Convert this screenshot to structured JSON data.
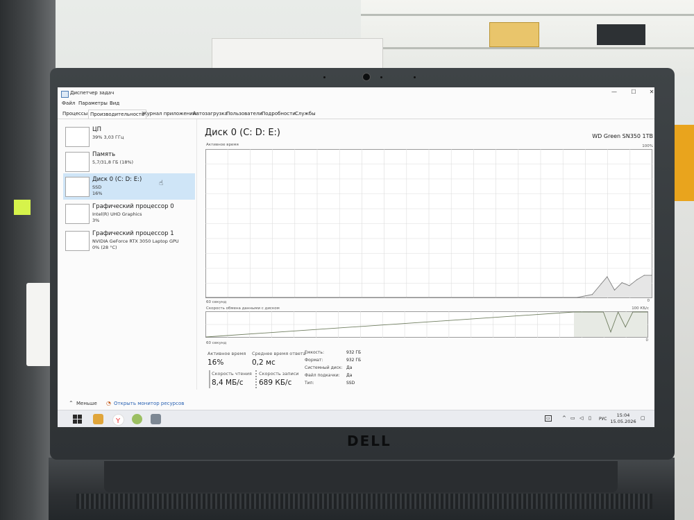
{
  "window": {
    "title": "Диспетчер задач",
    "controls": [
      "—",
      "☐",
      "✕"
    ]
  },
  "menu": [
    "Файл",
    "Параметры",
    "Вид"
  ],
  "tabs": [
    "Процессы",
    "Производительность",
    "Журнал приложений",
    "Автозагрузка",
    "Пользователи",
    "Подробности",
    "Службы"
  ],
  "active_tab_index": 1,
  "sidebar": {
    "items": [
      {
        "name": "ЦП",
        "sub1": "39%  3,03 ГГц",
        "sub2": ""
      },
      {
        "name": "Память",
        "sub1": "5,7/31,8 ГБ (18%)",
        "sub2": ""
      },
      {
        "name": "Диск 0 (C: D: E:)",
        "sub1": "SSD",
        "sub2": "16%"
      },
      {
        "name": "Графический процессор 0",
        "sub1": "Intel(R) UHD Graphics",
        "sub2": "3%"
      },
      {
        "name": "Графический процессор 1",
        "sub1": "NVIDIA GeForce RTX 3050 Laptop GPU",
        "sub2": "0%  (28 °C)"
      }
    ],
    "selected_index": 2
  },
  "main": {
    "title": "Диск 0 (C: D: E:)",
    "model": "WD Green SN350 1TB",
    "chart1": {
      "label": "Активное время",
      "max_label": "100%",
      "time_label": "60 секунд",
      "min_label": "0"
    },
    "chart2": {
      "label": "Скорость обмена данными с диском",
      "max_label": "100 КБ/с",
      "time_label": "60 секунд",
      "min_label": "0"
    }
  },
  "stats": {
    "active_time_label": "Активное время",
    "active_time_value": "16%",
    "avg_response_label": "Среднее время ответа",
    "avg_response_value": "0,2 мс",
    "read_speed_label": "Скорость чтения",
    "read_speed_value": "8,4 МБ/с",
    "write_speed_label": "Скорость записи",
    "write_speed_value": "689 КБ/с",
    "properties": [
      {
        "key": "Емкость:",
        "value": "932 ГБ"
      },
      {
        "key": "Формат:",
        "value": "932 ГБ"
      },
      {
        "key": "Системный диск:",
        "value": "Да"
      },
      {
        "key": "Файл подкачки:",
        "value": "Да"
      },
      {
        "key": "Тип:",
        "value": "SSD"
      }
    ]
  },
  "footer": {
    "less_label": "Меньше",
    "monitor_link": "Открыть монитор ресурсов"
  },
  "taskbar": {
    "lang": "РУС",
    "time": "15:04",
    "date": "15.05.2026",
    "tray_icons": [
      "display-icon",
      "chevron-up-icon",
      "network-icon",
      "volume-icon",
      "battery-icon",
      "notification-icon"
    ]
  },
  "brand": {
    "logo": "DELL"
  },
  "chart_data": [
    {
      "type": "area",
      "title": "Активное время",
      "xlabel": "60 секунд",
      "ylim": [
        0,
        100
      ],
      "x": [
        0,
        50,
        52,
        54,
        55,
        56,
        57,
        58,
        59,
        60
      ],
      "values": [
        0,
        0,
        2,
        14,
        5,
        10,
        8,
        12,
        15,
        15
      ],
      "grid": true
    },
    {
      "type": "line",
      "title": "Скорость обмена данными с диском",
      "xlabel": "60 секунд",
      "ylim": [
        0,
        100
      ],
      "x": [
        0,
        50,
        52,
        54,
        55,
        56,
        57,
        58,
        59,
        60
      ],
      "values": [
        0,
        100,
        100,
        100,
        20,
        100,
        40,
        100,
        100,
        100
      ],
      "grid": true
    }
  ]
}
